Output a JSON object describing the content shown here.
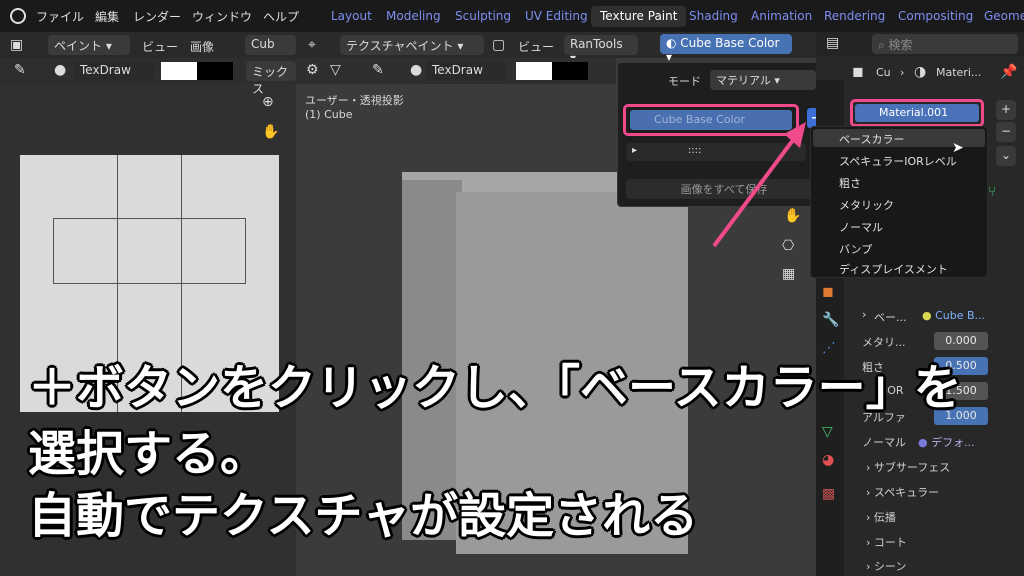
{
  "topbar": {
    "menus": [
      "ファイル",
      "編集",
      "レンダー",
      "ウィンドウ",
      "ヘルプ"
    ],
    "workspaces": [
      "Layout",
      "Modeling",
      "Sculpting",
      "UV Editing",
      "Texture Paint",
      "Shading",
      "Animation",
      "Rendering",
      "Compositing",
      "Geomet"
    ],
    "active_workspace": "Texture Paint"
  },
  "left_editor": {
    "mode": "ペイント",
    "view": "ビュー",
    "image": "画像",
    "cub_trunc": "Cub",
    "brush": "TexDraw",
    "blend_trunc": "ミックス"
  },
  "viewport": {
    "mode": "テクスチャペイント",
    "view": "ビュー",
    "addon": "RanTools",
    "active_slot": "Cube Base Color",
    "brush": "TexDraw",
    "info_line1": "ユーザー・透視投影",
    "info_line2": "(1) Cube"
  },
  "popover": {
    "mode_label": "モード",
    "mode_value": "マテリアル",
    "slot_name": "Cube Base Color",
    "save_all": "画像をすべて保存"
  },
  "add_menu": {
    "items": [
      "ベースカラー",
      "スペキュラーIORレベル",
      "粗さ",
      "メタリック",
      "ノーマル",
      "バンプ",
      "ディスプレイスメント"
    ],
    "highlighted": "ベースカラー"
  },
  "properties": {
    "search_placeholder": "検索",
    "breadcrumb_object": "Cu",
    "breadcrumb_material": "Materi...",
    "material_slot": "Material.001",
    "rows": [
      {
        "label": "ベー...",
        "value": "Cube B..."
      },
      {
        "label": "メタリ...",
        "value": "0.000"
      },
      {
        "label": "粗さ",
        "value": "0.500"
      },
      {
        "label": "IOR",
        "value": "1.500"
      },
      {
        "label": "アルファ",
        "value": "1.000"
      },
      {
        "label": "ノーマル",
        "value": "デフォ..."
      }
    ],
    "sections": [
      "サブサーフェス",
      "スペキュラー",
      "伝播",
      "コート",
      "シーン"
    ]
  },
  "caption": {
    "line1": "＋ボタンをクリックし、「ベースカラー」を",
    "line2": "選択する。",
    "line3": "自動でテクスチャが設定される"
  },
  "colors": {
    "highlight": "#f04a8a",
    "accent_blue": "#4772b3"
  }
}
